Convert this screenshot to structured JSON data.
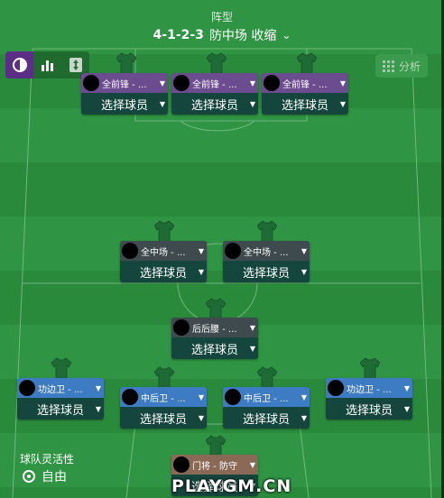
{
  "header": {
    "label": "阵型",
    "formation": "4-1-2-3",
    "style": "防中场 收缩"
  },
  "toolbar": {
    "icons": [
      "contrast-icon",
      "bar-chart-icon",
      "updown-arrows-icon"
    ]
  },
  "analysis": {
    "label": "分析",
    "icon": "grid-icon"
  },
  "player_placeholder": "选择球员",
  "players": [
    {
      "role": "全前锋 - ...",
      "line": "fw"
    },
    {
      "role": "全前锋 - ...",
      "line": "fw"
    },
    {
      "role": "全前锋 - ...",
      "line": "fw"
    },
    {
      "role": "全中场 - ...",
      "line": "mid"
    },
    {
      "role": "全中场 - ...",
      "line": "mid"
    },
    {
      "role": "后后腰 - ...",
      "line": "dm"
    },
    {
      "role": "功边卫 - ...",
      "line": "df"
    },
    {
      "role": "中后卫 - ...",
      "line": "df"
    },
    {
      "role": "中后卫 - ...",
      "line": "df"
    },
    {
      "role": "功边卫 - ...",
      "line": "df"
    },
    {
      "role": "门将 - 防守",
      "line": "gk"
    }
  ],
  "team_flexibility": {
    "label": "球队灵活性",
    "value": "自由"
  },
  "watermark": "PLAYGM.CN"
}
